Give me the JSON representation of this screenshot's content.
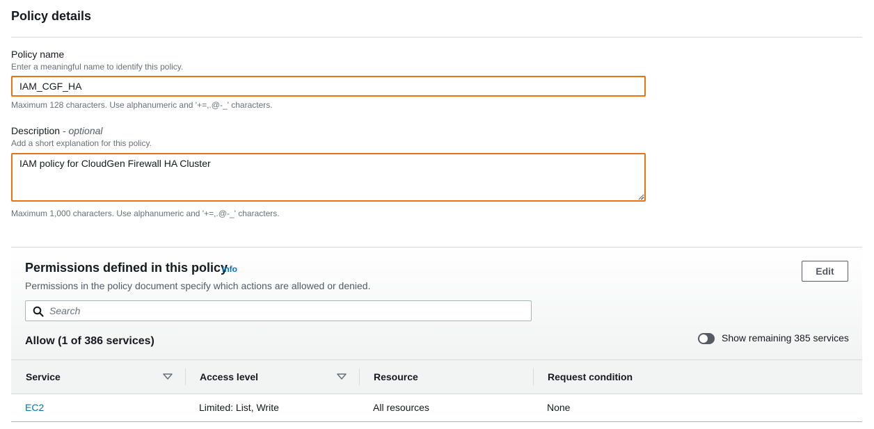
{
  "policy_details": {
    "title": "Policy details",
    "name": {
      "label": "Policy name",
      "description": "Enter a meaningful name to identify this policy.",
      "value": "IAM_CGF_HA",
      "hint": "Maximum 128 characters. Use alphanumeric and '+=,.@-_' characters."
    },
    "description": {
      "label": "Description",
      "optional": "- optional",
      "helper": "Add a short explanation for this policy.",
      "value": "IAM policy for CloudGen Firewall HA Cluster",
      "hint": "Maximum 1,000 characters. Use alphanumeric and '+=,.@-_' characters."
    }
  },
  "permissions": {
    "title": "Permissions defined in this policy",
    "info_link": "Info",
    "description": "Permissions in the policy document specify which actions are allowed or denied.",
    "edit_label": "Edit",
    "search_placeholder": "Search",
    "allow_title": "Allow (1 of 386 services)",
    "toggle_label": "Show remaining 385 services",
    "toggle_on": false,
    "table": {
      "headers": [
        "Service",
        "Access level",
        "Resource",
        "Request condition"
      ],
      "rows": [
        {
          "service": "EC2",
          "access_level": "Limited: List, Write",
          "resource": "All resources",
          "request_condition": "None"
        }
      ]
    }
  },
  "colors": {
    "focus_border": "#ec7211",
    "link": "#0073bb",
    "text": "#16191f",
    "muted": "#687078"
  }
}
